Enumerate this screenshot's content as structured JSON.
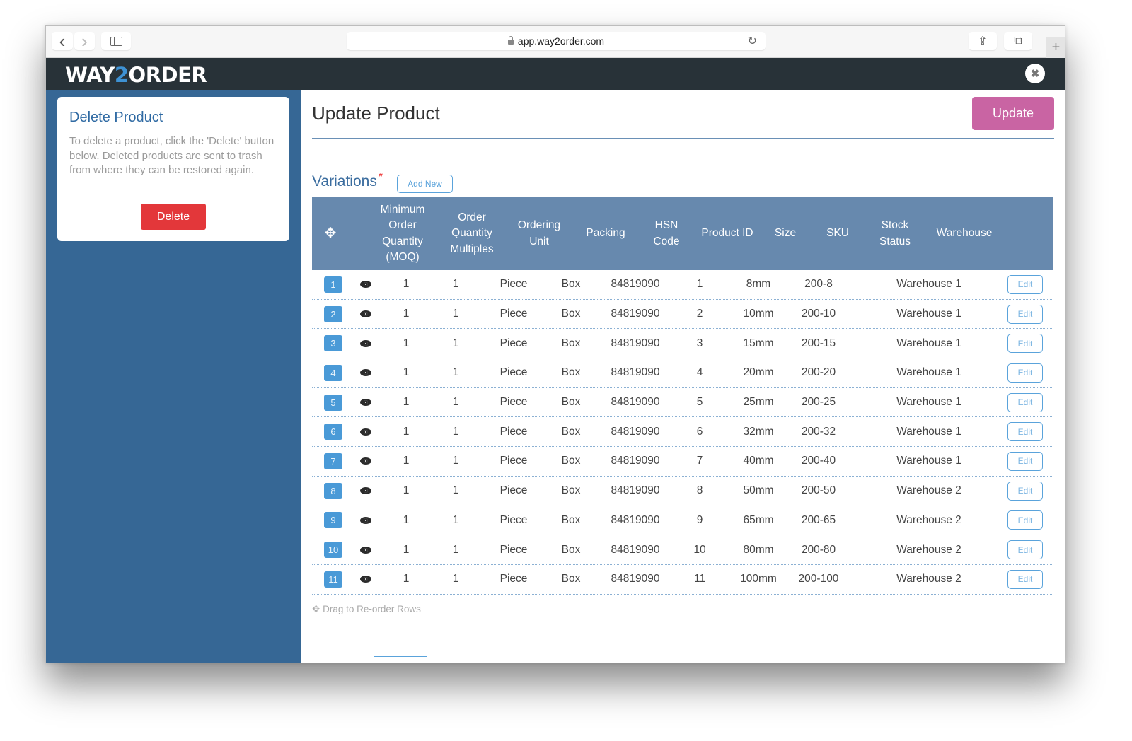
{
  "browser": {
    "url": "app.way2order.com",
    "icons": {
      "back": "chevron-left-icon",
      "forward": "chevron-right-icon",
      "sidebar": "sidebar-icon",
      "lock": "lock-icon",
      "reload": "reload-icon",
      "share": "share-icon",
      "tabs": "tabs-icon",
      "new_tab": "plus-icon"
    },
    "glyphs": {
      "back": "‹",
      "forward": "›",
      "reload": "↻",
      "share": "⇪",
      "tabs": "⧉",
      "new_tab": "+"
    }
  },
  "header": {
    "logo_pre": "WAY",
    "logo_accent": "2",
    "logo_post": "ORDER",
    "close_glyph": "✖",
    "accent_color": "#3e92d4"
  },
  "sidebar": {
    "delete_card": {
      "title": "Delete Product",
      "description": "To delete a product, click the 'Delete' button below. Deleted products are sent to trash from where they can be restored again.",
      "delete_label": "Delete"
    }
  },
  "main": {
    "title": "Update Product",
    "update_label": "Update",
    "variations_label": "Variations",
    "required_mark": "*",
    "add_new_label": "Add New",
    "drag_hint": "Drag to Re-order Rows",
    "drag_glyph": "✥"
  },
  "table": {
    "move_glyph": "✥",
    "columns": [
      "",
      "Minimum Order Quantity (MOQ)",
      "Order Quantity Multiples",
      "Ordering Unit",
      "Packing",
      "HSN Code",
      "Product ID",
      "Size",
      "SKU",
      "Stock Status",
      "Warehouse"
    ],
    "edit_label": "Edit",
    "rows": [
      {
        "index": "1",
        "moq": "1",
        "multiples": "1",
        "unit": "Piece",
        "packing": "Box",
        "hsn": "84819090",
        "product_id": "1",
        "size": "8mm",
        "sku": "200-8",
        "warehouse": "Warehouse 1"
      },
      {
        "index": "2",
        "moq": "1",
        "multiples": "1",
        "unit": "Piece",
        "packing": "Box",
        "hsn": "84819090",
        "product_id": "2",
        "size": "10mm",
        "sku": "200-10",
        "warehouse": "Warehouse 1"
      },
      {
        "index": "3",
        "moq": "1",
        "multiples": "1",
        "unit": "Piece",
        "packing": "Box",
        "hsn": "84819090",
        "product_id": "3",
        "size": "15mm",
        "sku": "200-15",
        "warehouse": "Warehouse 1"
      },
      {
        "index": "4",
        "moq": "1",
        "multiples": "1",
        "unit": "Piece",
        "packing": "Box",
        "hsn": "84819090",
        "product_id": "4",
        "size": "20mm",
        "sku": "200-20",
        "warehouse": "Warehouse 1"
      },
      {
        "index": "5",
        "moq": "1",
        "multiples": "1",
        "unit": "Piece",
        "packing": "Box",
        "hsn": "84819090",
        "product_id": "5",
        "size": "25mm",
        "sku": "200-25",
        "warehouse": "Warehouse 1"
      },
      {
        "index": "6",
        "moq": "1",
        "multiples": "1",
        "unit": "Piece",
        "packing": "Box",
        "hsn": "84819090",
        "product_id": "6",
        "size": "32mm",
        "sku": "200-32",
        "warehouse": "Warehouse 1"
      },
      {
        "index": "7",
        "moq": "1",
        "multiples": "1",
        "unit": "Piece",
        "packing": "Box",
        "hsn": "84819090",
        "product_id": "7",
        "size": "40mm",
        "sku": "200-40",
        "warehouse": "Warehouse 1"
      },
      {
        "index": "8",
        "moq": "1",
        "multiples": "1",
        "unit": "Piece",
        "packing": "Box",
        "hsn": "84819090",
        "product_id": "8",
        "size": "50mm",
        "sku": "200-50",
        "warehouse": "Warehouse 2"
      },
      {
        "index": "9",
        "moq": "1",
        "multiples": "1",
        "unit": "Piece",
        "packing": "Box",
        "hsn": "84819090",
        "product_id": "9",
        "size": "65mm",
        "sku": "200-65",
        "warehouse": "Warehouse 2"
      },
      {
        "index": "10",
        "moq": "1",
        "multiples": "1",
        "unit": "Piece",
        "packing": "Box",
        "hsn": "84819090",
        "product_id": "10",
        "size": "80mm",
        "sku": "200-80",
        "warehouse": "Warehouse 2"
      },
      {
        "index": "11",
        "moq": "1",
        "multiples": "1",
        "unit": "Piece",
        "packing": "Box",
        "hsn": "84819090",
        "product_id": "11",
        "size": "100mm",
        "sku": "200-100",
        "warehouse": "Warehouse 2"
      }
    ]
  }
}
